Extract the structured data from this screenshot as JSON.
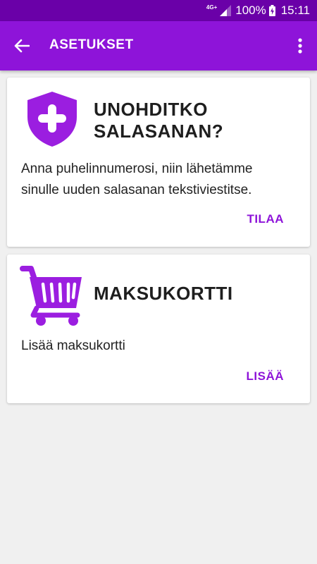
{
  "status_bar": {
    "network": "4G+",
    "battery_percent": "100%",
    "time": "15:11"
  },
  "app_bar": {
    "title": "ASETUKSET",
    "back_icon": "arrow-back-icon",
    "menu_icon": "more-vert-icon"
  },
  "cards": {
    "password": {
      "icon": "shield-plus-icon",
      "title_line1": "UNOHDITKO",
      "title_line2": "SALASANAN?",
      "body_line1": "Anna puhelinnumerosi, niin lähetämme",
      "body_line2": "sinulle uuden salasanan tekstiviestitse.",
      "action": "TILAA"
    },
    "payment": {
      "icon": "shopping-cart-icon",
      "title": "MAKSUKORTTI",
      "body": "Lisää maksukortti",
      "action": "LISÄÄ"
    }
  },
  "colors": {
    "status_bar": "#6a00a8",
    "app_bar": "#8e14d9",
    "accent": "#8e14d9",
    "icon": "#9b1ee0",
    "background": "#f0f0f0"
  }
}
